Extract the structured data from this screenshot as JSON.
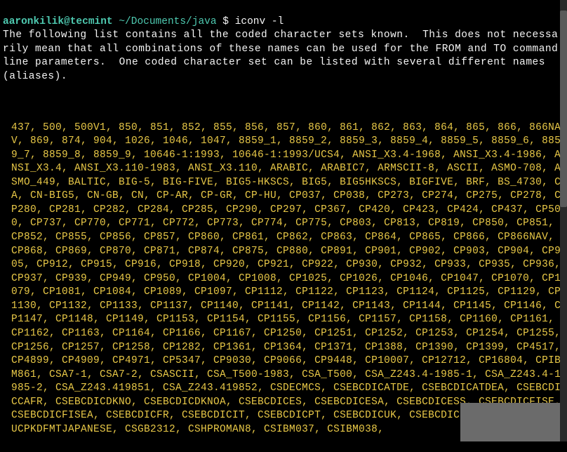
{
  "prompt": {
    "user": "aaronkilik@tecmint",
    "path": "~/Documents/java",
    "dollar": "$",
    "command": "iconv -l"
  },
  "intro": "The following list contains all the coded character sets known.  This does not necessarily mean that all combinations of these names can be used for the FROM and TO command line parameters.  One coded character set can be listed with several different names (aliases).",
  "charsets": "437, 500, 500V1, 850, 851, 852, 855, 856, 857, 860, 861, 862, 863, 864, 865, 866, 866NAV, 869, 874, 904, 1026, 1046, 1047, 8859_1, 8859_2, 8859_3, 8859_4, 8859_5, 8859_6, 8859_7, 8859_8, 8859_9, 10646-1:1993, 10646-1:1993/UCS4, ANSI_X3.4-1968, ANSI_X3.4-1986, ANSI_X3.4, ANSI_X3.110-1983, ANSI_X3.110, ARABIC, ARABIC7, ARMSCII-8, ASCII, ASMO-708, ASMO_449, BALTIC, BIG-5, BIG-FIVE, BIG5-HKSCS, BIG5, BIG5HKSCS, BIGFIVE, BRF, BS_4730, CA, CN-BIG5, CN-GB, CN, CP-AR, CP-GR, CP-HU, CP037, CP038, CP273, CP274, CP275, CP278, CP280, CP281, CP282, CP284, CP285, CP290, CP297, CP367, CP420, CP423, CP424, CP437, CP500, CP737, CP770, CP771, CP772, CP773, CP774, CP775, CP803, CP813, CP819, CP850, CP851, CP852, CP855, CP856, CP857, CP860, CP861, CP862, CP863, CP864, CP865, CP866, CP866NAV, CP868, CP869, CP870, CP871, CP874, CP875, CP880, CP891, CP901, CP902, CP903, CP904, CP905, CP912, CP915, CP916, CP918, CP920, CP921, CP922, CP930, CP932, CP933, CP935, CP936, CP937, CP939, CP949, CP950, CP1004, CP1008, CP1025, CP1026, CP1046, CP1047, CP1070, CP1079, CP1081, CP1084, CP1089, CP1097, CP1112, CP1122, CP1123, CP1124, CP1125, CP1129, CP1130, CP1132, CP1133, CP1137, CP1140, CP1141, CP1142, CP1143, CP1144, CP1145, CP1146, CP1147, CP1148, CP1149, CP1153, CP1154, CP1155, CP1156, CP1157, CP1158, CP1160, CP1161, CP1162, CP1163, CP1164, CP1166, CP1167, CP1250, CP1251, CP1252, CP1253, CP1254, CP1255, CP1256, CP1257, CP1258, CP1282, CP1361, CP1364, CP1371, CP1388, CP1390, CP1399, CP4517, CP4899, CP4909, CP4971, CP5347, CP9030, CP9066, CP9448, CP10007, CP12712, CP16804, CPIBM861, CSA7-1, CSA7-2, CSASCII, CSA_T500-1983, CSA_T500, CSA_Z243.4-1985-1, CSA_Z243.4-1985-2, CSA_Z243.419851, CSA_Z243.419852, CSDECMCS, CSEBCDICATDE, CSEBCDICATDEA, CSEBCDICCAFR, CSEBCDICDKNO, CSEBCDICDKNOA, CSEBCDICES, CSEBCDICESA, CSEBCDICESS, CSEBCDICFISE, CSEBCDICFISEA, CSEBCDICFR, CSEBCDICIT, CSEBCDICPT, CSEBCDICUK, CSEBCDICUS, CSEUCKR, CSEUCPKDFMTJAPANESE, CSGB2312, CSHPROMAN8, CSIBM037, CSIBM038,"
}
